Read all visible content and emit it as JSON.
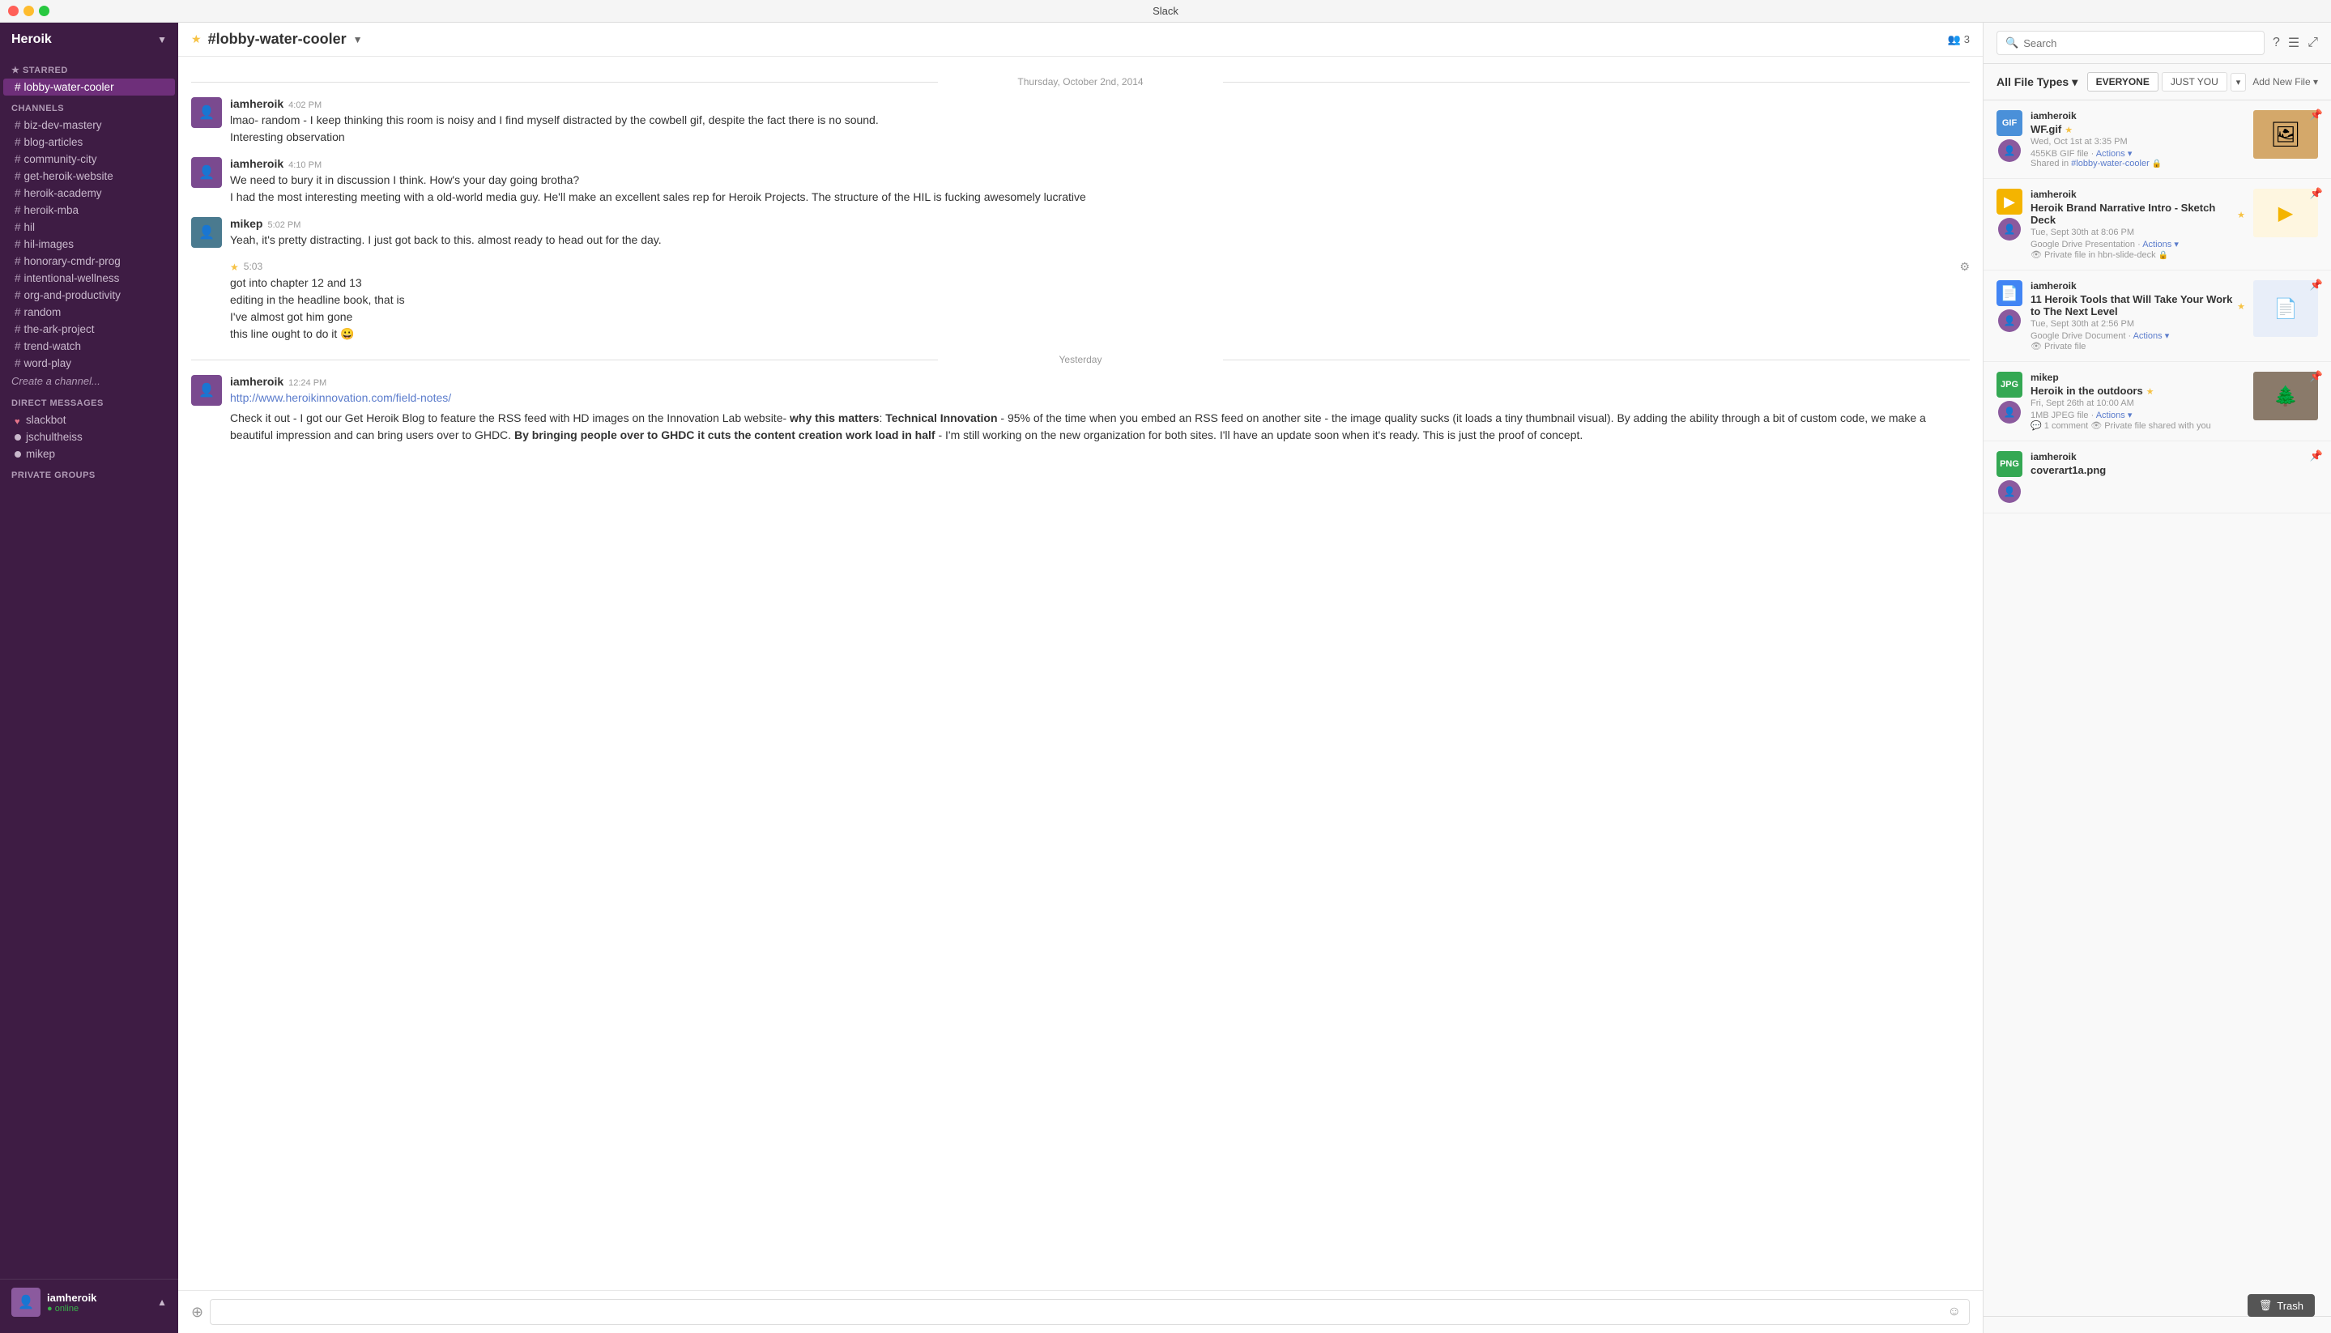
{
  "app": {
    "title": "Slack"
  },
  "sidebar": {
    "workspace": "Heroik",
    "starred_section": "STARRED",
    "starred_items": [
      {
        "id": "lobby-water-cooler",
        "label": "lobby-water-cooler",
        "prefix": "#",
        "active": true
      }
    ],
    "channels_section": "CHANNELS",
    "channels": [
      {
        "id": "biz-dev-mastery",
        "label": "biz-dev-mastery",
        "prefix": "#"
      },
      {
        "id": "blog-articles",
        "label": "blog-articles",
        "prefix": "#"
      },
      {
        "id": "community-city",
        "label": "community-city",
        "prefix": "#"
      },
      {
        "id": "get-heroik-website",
        "label": "get-heroik-website",
        "prefix": "#"
      },
      {
        "id": "heroik-academy",
        "label": "heroik-academy",
        "prefix": "#"
      },
      {
        "id": "heroik-mba",
        "label": "heroik-mba",
        "prefix": "#"
      },
      {
        "id": "hil",
        "label": "hil",
        "prefix": "#"
      },
      {
        "id": "hil-images",
        "label": "hil-images",
        "prefix": "#"
      },
      {
        "id": "honorary-cmdr-prog",
        "label": "honorary-cmdr-prog",
        "prefix": "#"
      },
      {
        "id": "intentional-wellness",
        "label": "intentional-wellness",
        "prefix": "#"
      },
      {
        "id": "org-and-productivity",
        "label": "org-and-productivity",
        "prefix": "#"
      },
      {
        "id": "random",
        "label": "random",
        "prefix": "#"
      },
      {
        "id": "the-ark-project",
        "label": "the-ark-project",
        "prefix": "#"
      },
      {
        "id": "trend-watch",
        "label": "trend-watch",
        "prefix": "#"
      },
      {
        "id": "word-play",
        "label": "word-play",
        "prefix": "#"
      }
    ],
    "create_channel": "Create a channel...",
    "dm_section": "DIRECT MESSAGES",
    "dms": [
      {
        "id": "slackbot",
        "label": "slackbot",
        "status": "heart"
      },
      {
        "id": "jschultheiss",
        "label": "jschultheiss",
        "status": "away"
      },
      {
        "id": "mikep",
        "label": "mikep",
        "status": "away"
      }
    ],
    "private_groups_section": "PRIVATE GROUPS",
    "user": {
      "name": "iamheroik",
      "status": "online",
      "status_label": "● online"
    }
  },
  "chat": {
    "channel_name": "#lobby-water-cooler",
    "channel_prefix": "#",
    "channel_slug": "lobby-water-cooler",
    "member_count": "3",
    "date_divider_1": "Thursday, October 2nd, 2014",
    "date_divider_2": "Yesterday",
    "messages": [
      {
        "author": "iamheroik",
        "time": "4:02 PM",
        "lines": [
          "lmao- random - I keep thinking this room is noisy and I find myself distracted by the cowbell gif, despite the fact there is no sound.",
          "Interesting observation"
        ]
      },
      {
        "author": "iamheroik",
        "time": "4:10 PM",
        "lines": [
          "We need to bury it in discussion I think. How's your day going brotha?",
          "I had the most interesting meeting with a old-world media guy. He'll make an excellent sales rep for Heroik Projects. The structure of the HIL is fucking awesomely lucrative"
        ]
      },
      {
        "author": "mikep",
        "time": "5:02 PM",
        "lines": [
          "Yeah, it's pretty distracting.  I just got back to this.  almost ready to head out for the day."
        ]
      },
      {
        "author": "",
        "time": "5:03",
        "starred": true,
        "lines": [
          "got into chapter 12 and 13",
          "editing in the headline book, that is",
          "I've almost got him gone",
          "this line ought to do it 😀"
        ]
      }
    ],
    "yesterday_message": {
      "author": "iamheroik",
      "time": "12:24 PM",
      "link": "http://www.heroikinnovation.com/field-notes/",
      "text_parts": [
        {
          "type": "text",
          "content": "Check it out - I got our Get Heroik Blog to feature the RSS feed with HD images on the Innovation Lab website- "
        },
        {
          "type": "bold",
          "content": "why this matters"
        },
        {
          "type": "text",
          "content": ":  "
        },
        {
          "type": "bold",
          "content": "Technical Innovation"
        },
        {
          "type": "text",
          "content": " - 95% of the time when you embed an RSS feed on another site - the image quality sucks (it loads a tiny thumbnail visual).  By adding the ability through a bit of custom code, we make a beautiful impression and can bring users over to GHDC. "
        },
        {
          "type": "bold",
          "content": "By bringing people over to GHDC it cuts the content creation work load in half"
        },
        {
          "type": "text",
          "content": " - I'm still working on the new organization for both sites. I'll have an update soon when it's ready. This is just the proof of concept."
        }
      ]
    },
    "input_placeholder": ""
  },
  "right_panel": {
    "search_placeholder": "Search",
    "file_type_label": "All File Types",
    "filter_everyone": "EVERYONE",
    "filter_just_you": "JUST YOU",
    "add_new_file": "Add New File ▾",
    "files": [
      {
        "id": "wf-gif",
        "author": "iamheroik",
        "name": "WF.gif",
        "starred": true,
        "date": "Wed, Oct 1st at 3:35 PM",
        "meta": "455KB GIF file · Actions ▾",
        "shared": "Shared in #lobby-water-cooler",
        "type": "gif",
        "has_thumbnail": true
      },
      {
        "id": "heroik-brand-narrative",
        "author": "iamheroik",
        "name": "Heroik Brand Narrative Intro - Sketch Deck",
        "starred": true,
        "date": "Tue, Sept 30th at 8:06 PM",
        "meta": "Google Drive Presentation · Actions ▾",
        "shared": "Private file in hbn-slide-deck",
        "type": "gpres",
        "has_thumbnail": true
      },
      {
        "id": "11-heroik-tools",
        "author": "iamheroik",
        "name": "11 Heroik Tools that Will Take Your Work to The Next Level",
        "starred": true,
        "date": "Tue, Sept 30th at 2:56 PM",
        "meta": "Google Drive Document · Actions ▾",
        "shared": "Private file",
        "type": "gdoc",
        "has_thumbnail": true
      },
      {
        "id": "heroik-outdoors",
        "author": "mikep",
        "name": "Heroik in the outdoors",
        "starred": true,
        "date": "Fri, Sept 26th at 10:00 AM",
        "meta": "1MB JPEG file · Actions ▾",
        "shared": "1 comment 👁 Private file shared with you",
        "type": "jpeg",
        "has_thumbnail": true
      },
      {
        "id": "coverart1a",
        "author": "iamheroik",
        "name": "coverart1a.png",
        "starred": false,
        "date": "",
        "meta": "",
        "shared": "",
        "type": "jpeg",
        "has_thumbnail": false
      }
    ],
    "trash_label": "Trash"
  }
}
